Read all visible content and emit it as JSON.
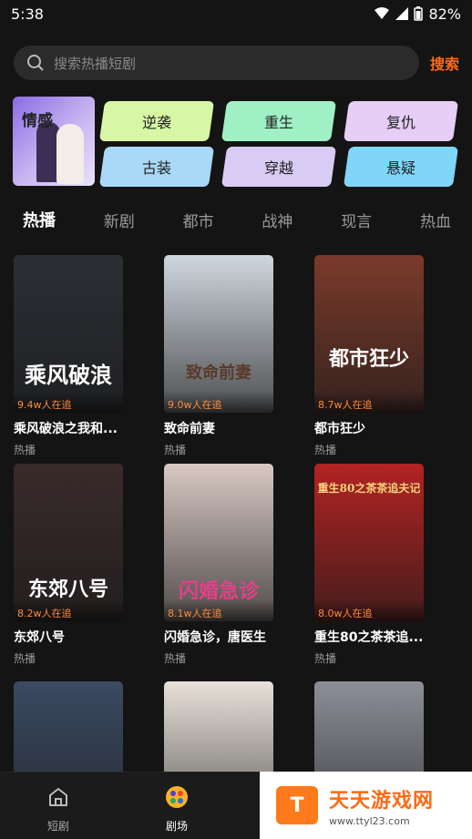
{
  "status": {
    "time": "5:38",
    "battery": "82%"
  },
  "search": {
    "placeholder": "搜索热播短剧",
    "button": "搜索"
  },
  "categories": {
    "feature": "情感",
    "tiles": [
      "逆袭",
      "重生",
      "复仇",
      "古装",
      "穿越",
      "悬疑"
    ],
    "colors": [
      "#d8f7a6",
      "#9ff0c4",
      "#e6cef7",
      "#a8d9f7",
      "#d8ccf4",
      "#7fd6f8"
    ]
  },
  "tabs": [
    "热播",
    "新剧",
    "都市",
    "战神",
    "现言",
    "热血"
  ],
  "cards": [
    {
      "title": "乘风破浪之我和...",
      "sub": "热播",
      "watch": "9.4w人在追",
      "poster_text": "乘风破浪",
      "bg": "#2b2f35"
    },
    {
      "title": "致命前妻",
      "sub": "热播",
      "watch": "9.0w人在追",
      "poster_text": "致命前妻",
      "bg": "#cfd7de"
    },
    {
      "title": "都市狂少",
      "sub": "热播",
      "watch": "8.7w人在追",
      "poster_text": "都市狂少",
      "bg": "#7a3a2a"
    },
    {
      "title": "东郊八号",
      "sub": "热播",
      "watch": "8.2w人在追",
      "poster_text": "东郊八号",
      "bg": "#3a2a2a"
    },
    {
      "title": "闪婚急诊，唐医生",
      "sub": "热播",
      "watch": "8.1w人在追",
      "poster_text": "闪婚急诊",
      "bg": "#d9c9c4"
    },
    {
      "title": "重生80之茶茶追...",
      "sub": "热播",
      "watch": "8.0w人在追",
      "poster_text": "重生80之茶茶追夫记",
      "bg": "#b32323"
    },
    {
      "title": "",
      "sub": "",
      "watch": "",
      "poster_text": "",
      "bg": "#3b4a62"
    },
    {
      "title": "",
      "sub": "",
      "watch": "",
      "poster_text": "",
      "bg": "#e8e1da"
    },
    {
      "title": "",
      "sub": "",
      "watch": "",
      "poster_text": "",
      "bg": "#8c8f98"
    }
  ],
  "nav": [
    {
      "label": "短剧",
      "icon": "home-icon"
    },
    {
      "label": "剧场",
      "icon": "theater-icon"
    }
  ],
  "watermark": {
    "title": "天天游戏网",
    "url": "www.ttyl23.com"
  }
}
